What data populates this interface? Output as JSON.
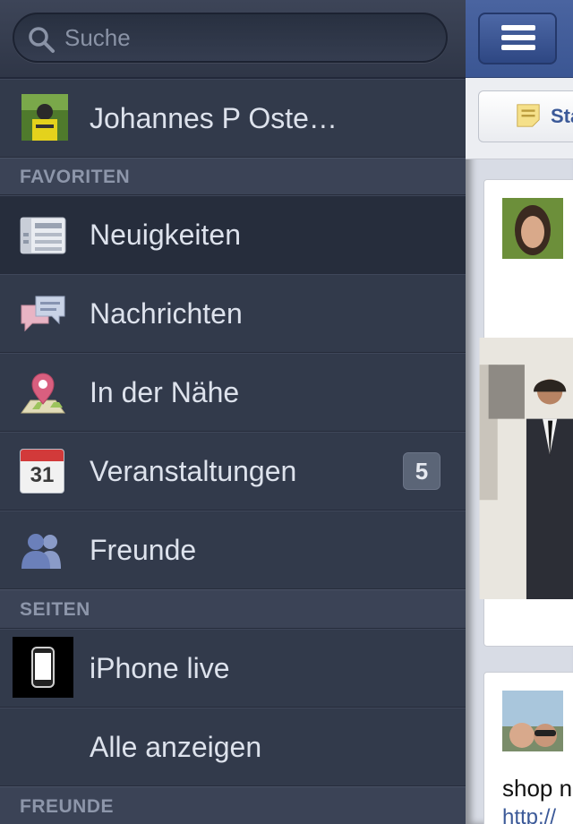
{
  "search": {
    "placeholder": "Suche"
  },
  "profile": {
    "name": "Johannes P Oste…"
  },
  "sections": {
    "favorites": "FAVORITEN",
    "pages": "SEITEN",
    "friends": "FREUNDE"
  },
  "favorites": [
    {
      "label": "Neuigkeiten",
      "icon": "news-feed-icon"
    },
    {
      "label": "Nachrichten",
      "icon": "messages-icon"
    },
    {
      "label": "In der Nähe",
      "icon": "nearby-pin-icon"
    },
    {
      "label": "Veranstaltungen",
      "icon": "calendar-icon",
      "badge": "5",
      "calendar_day": "31"
    },
    {
      "label": "Freunde",
      "icon": "friends-icon"
    }
  ],
  "pages": [
    {
      "label": "iPhone live"
    },
    {
      "label": "Alle anzeigen"
    }
  ],
  "main": {
    "status_button": "Sta",
    "post2_text": "shop n",
    "post2_link": "http://"
  },
  "colors": {
    "sidebar_bg": "#323a4b",
    "topbar_blue": "#3b5693",
    "link_blue": "#3b5998"
  }
}
